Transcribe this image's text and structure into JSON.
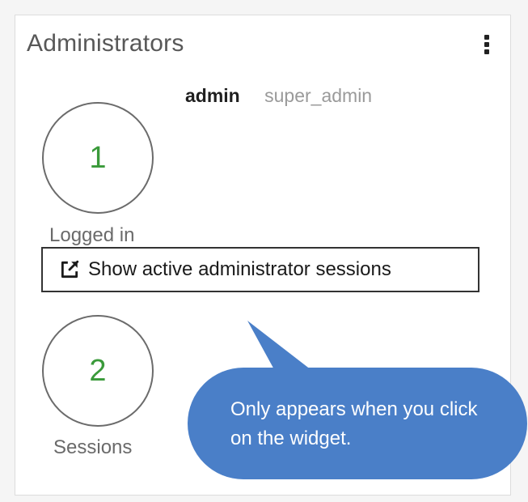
{
  "widget": {
    "title": "Administrators",
    "menu_icon": "vertical-ellipsis-icon"
  },
  "admin": {
    "name": "admin",
    "role": "super_admin"
  },
  "stats": {
    "logged_in": {
      "value": "1",
      "label": "Logged in"
    },
    "sessions": {
      "value": "2",
      "label": "Sessions"
    }
  },
  "sessions_link": {
    "label": "Show active administrator sessions",
    "icon": "external-link-icon"
  },
  "callout": {
    "text": "Only appears when you click on the widget.",
    "color": "#4a7fc8"
  },
  "colors": {
    "stat_value": "#3a9a3a",
    "muted_text": "#9a9a9a"
  }
}
